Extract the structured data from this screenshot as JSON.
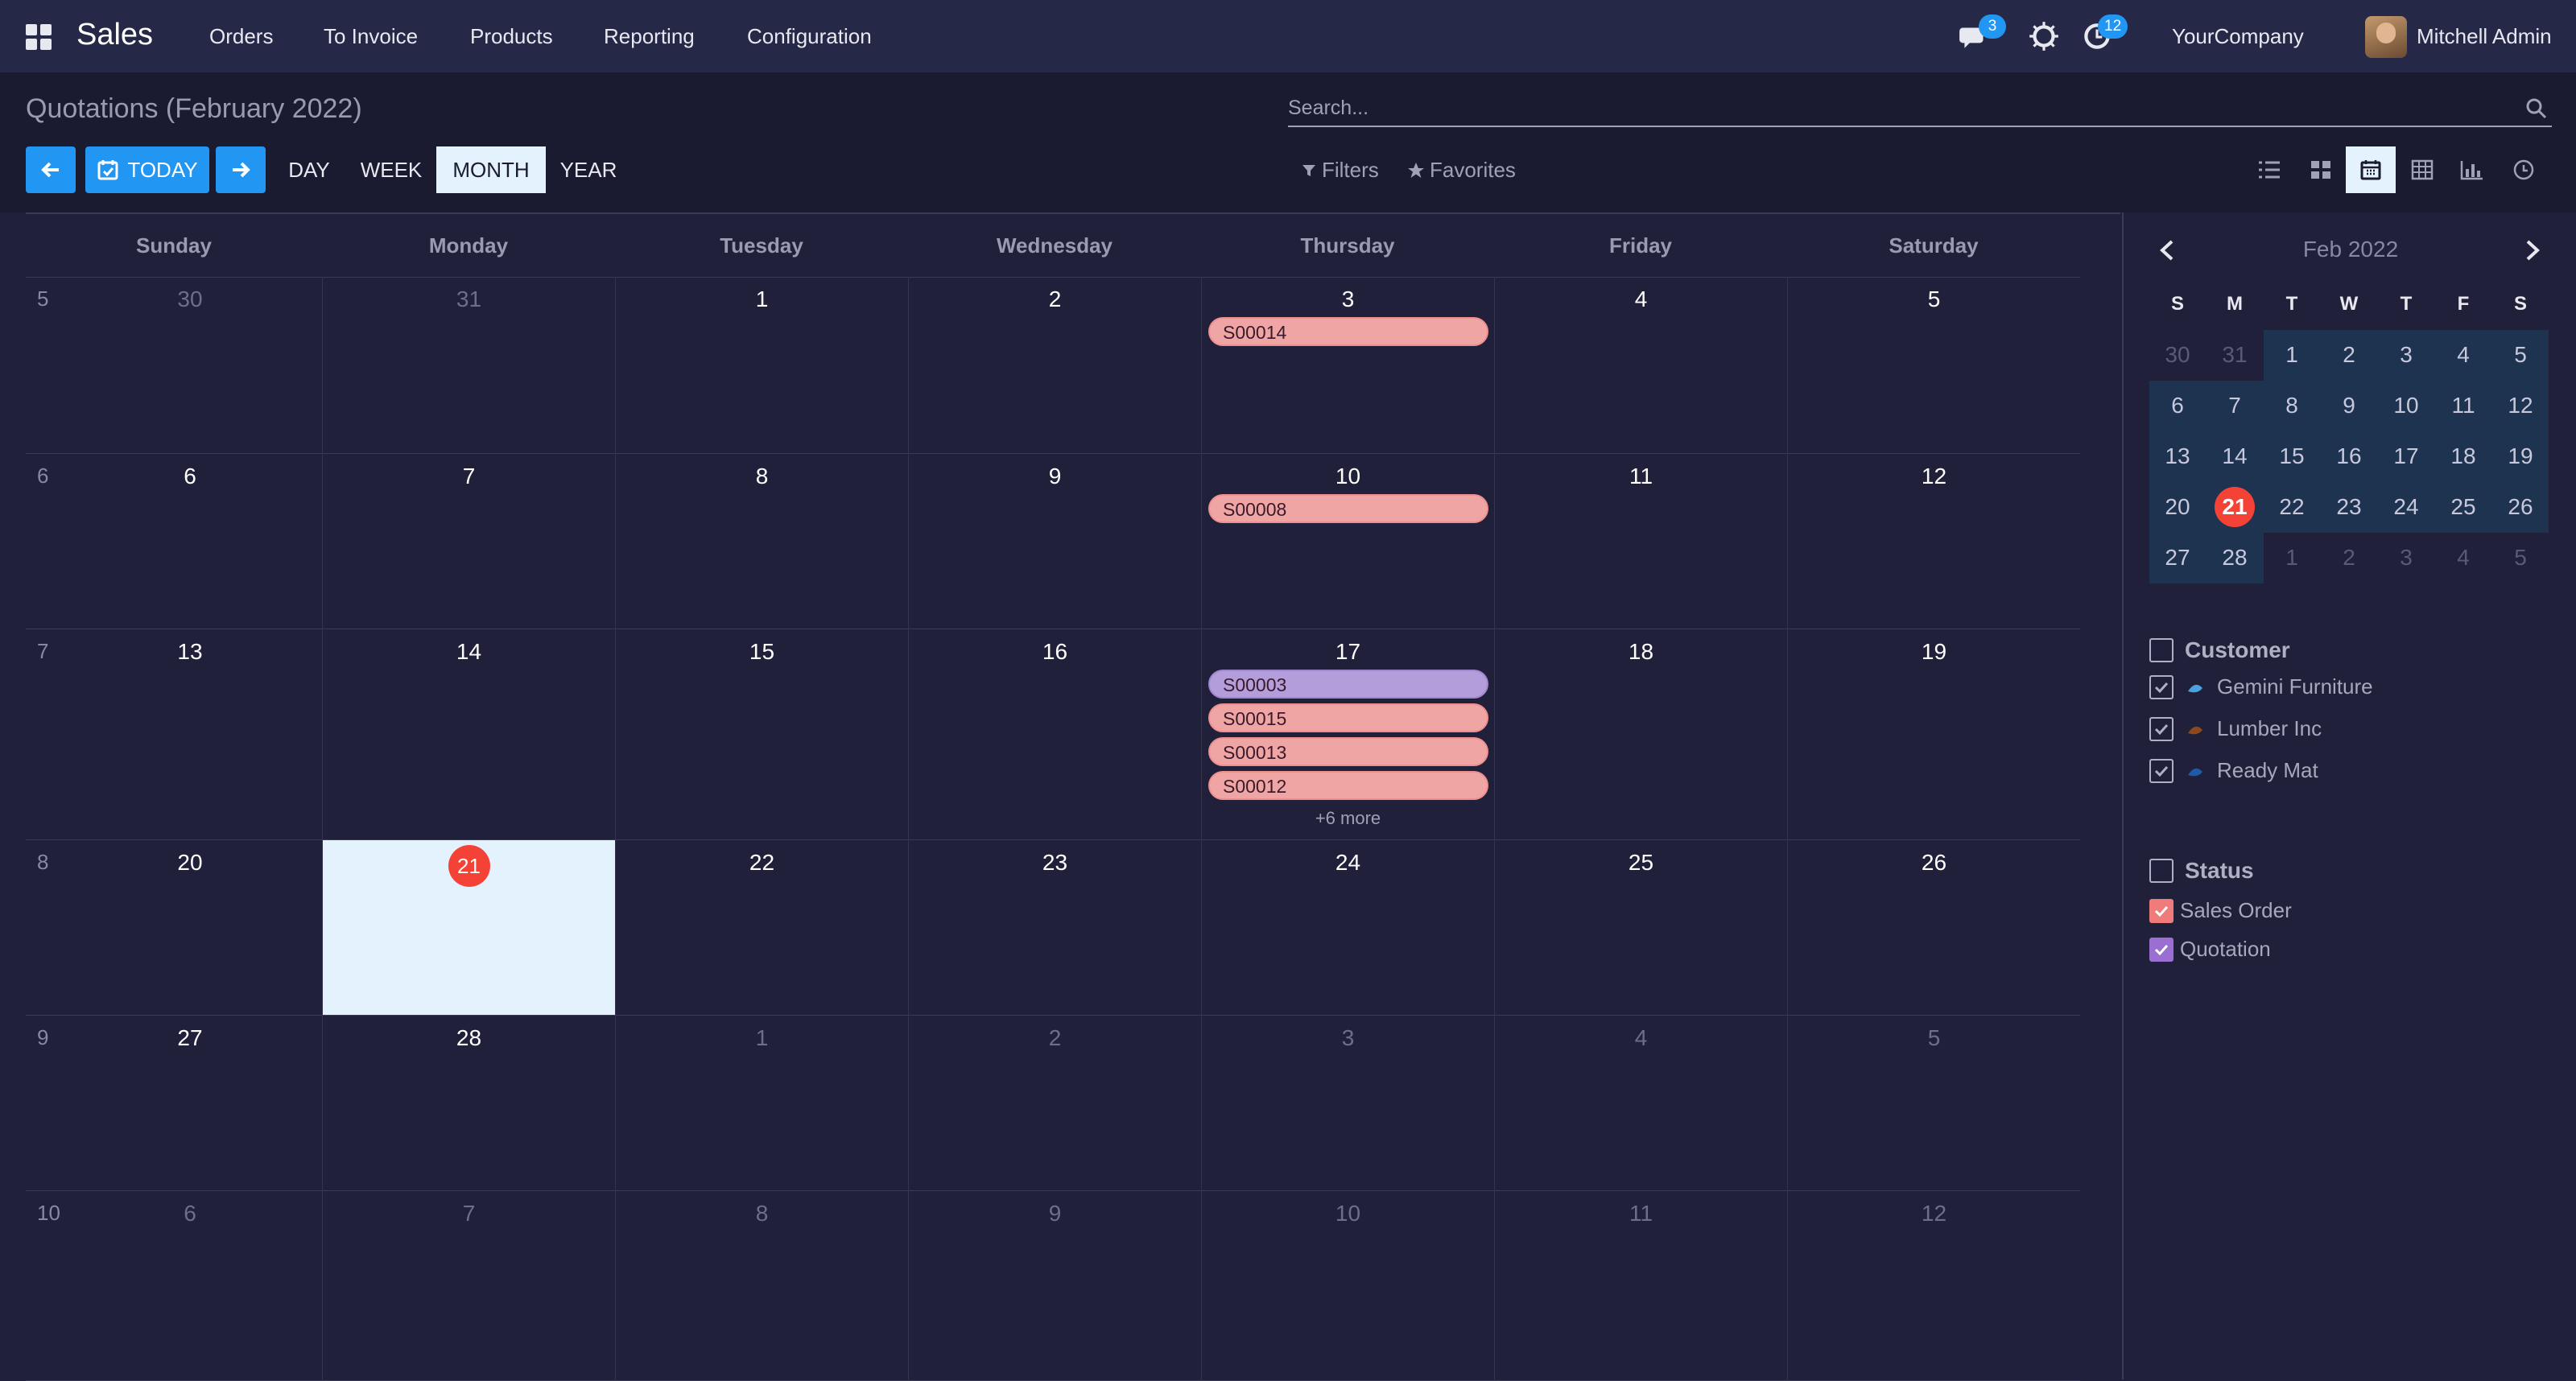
{
  "navbar": {
    "app_name": "Sales",
    "menu": [
      "Orders",
      "To Invoice",
      "Products",
      "Reporting",
      "Configuration"
    ],
    "messages_count": "3",
    "activities_count": "12",
    "company": "YourCompany",
    "user": "Mitchell Admin"
  },
  "control_panel": {
    "title": "Quotations (February 2022)",
    "search_placeholder": "Search...",
    "today_label": "TODAY",
    "range_day": "DAY",
    "range_week": "WEEK",
    "range_month": "MONTH",
    "range_year": "YEAR",
    "active_range": "MONTH",
    "filters_label": "Filters",
    "favorites_label": "Favorites",
    "views": [
      "list-view-icon",
      "kanban-view-icon",
      "calendar-view-icon",
      "pivot-view-icon",
      "graph-view-icon",
      "activity-view-icon"
    ],
    "active_view": "calendar-view-icon"
  },
  "calendar": {
    "weekdays": [
      "Sunday",
      "Monday",
      "Tuesday",
      "Wednesday",
      "Thursday",
      "Friday",
      "Saturday"
    ],
    "weeks": [
      {
        "week": "5",
        "days": [
          "30",
          "31",
          "1",
          "2",
          "3",
          "4",
          "5"
        ],
        "muted": [
          true,
          true,
          false,
          false,
          false,
          false,
          false
        ]
      },
      {
        "week": "6",
        "days": [
          "6",
          "7",
          "8",
          "9",
          "10",
          "11",
          "12"
        ],
        "muted": [
          false,
          false,
          false,
          false,
          false,
          false,
          false
        ]
      },
      {
        "week": "7",
        "days": [
          "13",
          "14",
          "15",
          "16",
          "17",
          "18",
          "19"
        ],
        "muted": [
          false,
          false,
          false,
          false,
          false,
          false,
          false
        ]
      },
      {
        "week": "8",
        "days": [
          "20",
          "21",
          "22",
          "23",
          "24",
          "25",
          "26"
        ],
        "muted": [
          false,
          false,
          false,
          false,
          false,
          false,
          false
        ]
      },
      {
        "week": "9",
        "days": [
          "27",
          "28",
          "1",
          "2",
          "3",
          "4",
          "5"
        ],
        "muted": [
          false,
          false,
          true,
          true,
          true,
          true,
          true
        ]
      },
      {
        "week": "10",
        "days": [
          "6",
          "7",
          "8",
          "9",
          "10",
          "11",
          "12"
        ],
        "muted": [
          true,
          true,
          true,
          true,
          true,
          true,
          true
        ]
      }
    ],
    "today": {
      "week_index": 3,
      "day_index": 1,
      "label": "21"
    },
    "events": [
      {
        "week_index": 0,
        "day_index": 4,
        "label": "S00014",
        "status": "sales"
      },
      {
        "week_index": 1,
        "day_index": 4,
        "label": "S00008",
        "status": "sales"
      },
      {
        "week_index": 2,
        "day_index": 4,
        "label": "S00003",
        "status": "quote"
      },
      {
        "week_index": 2,
        "day_index": 4,
        "label": "S00015",
        "status": "sales"
      },
      {
        "week_index": 2,
        "day_index": 4,
        "label": "S00013",
        "status": "sales"
      },
      {
        "week_index": 2,
        "day_index": 4,
        "label": "S00012",
        "status": "sales"
      }
    ],
    "more": {
      "week_index": 2,
      "day_index": 4,
      "label": "+6 more"
    }
  },
  "sidebar": {
    "mini_title": "Feb 2022",
    "mini_dow": [
      "S",
      "M",
      "T",
      "W",
      "T",
      "F",
      "S"
    ],
    "mini_weeks": [
      [
        "30",
        "31",
        "1",
        "2",
        "3",
        "4",
        "5"
      ],
      [
        "6",
        "7",
        "8",
        "9",
        "10",
        "11",
        "12"
      ],
      [
        "13",
        "14",
        "15",
        "16",
        "17",
        "18",
        "19"
      ],
      [
        "20",
        "21",
        "22",
        "23",
        "24",
        "25",
        "26"
      ],
      [
        "27",
        "28",
        "1",
        "2",
        "3",
        "4",
        "5"
      ]
    ],
    "customer_heading": "Customer",
    "customers": [
      {
        "name": "Gemini Furniture",
        "icon": "gemini-logo-icon",
        "color": "#4aa3df"
      },
      {
        "name": "Lumber Inc",
        "icon": "lumber-logo-icon",
        "color": "#8b4a1e"
      },
      {
        "name": "Ready Mat",
        "icon": "ready-mat-logo-icon",
        "color": "#1e5aa8"
      }
    ],
    "status_heading": "Status",
    "statuses": [
      {
        "name": "Sales Order",
        "color": "#f07b7b"
      },
      {
        "name": "Quotation",
        "color": "#9b6fd1"
      }
    ]
  },
  "colors": {
    "accent": "#2196f3",
    "today": "#f44336",
    "sales_order": "#f0a5a5",
    "quotation": "#b39ddb"
  }
}
